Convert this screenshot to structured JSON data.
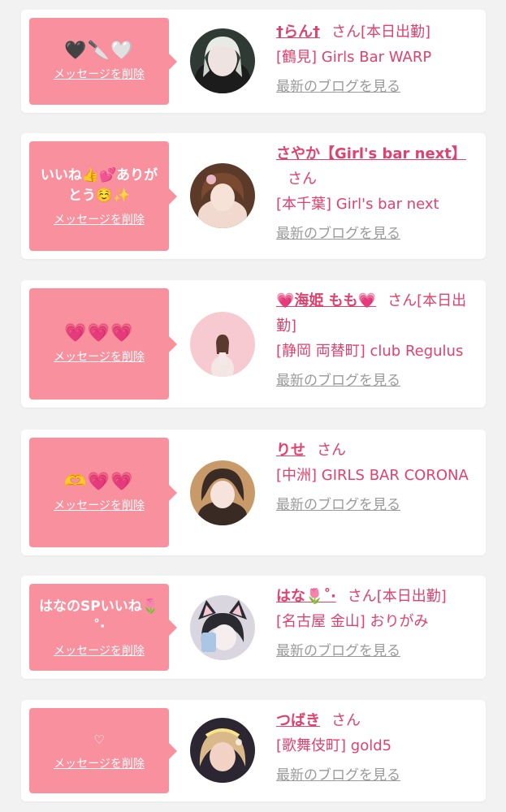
{
  "cards": [
    {
      "message": "🖤🔪🤍",
      "delete_label": "メッセージを削除",
      "name": "†らん†",
      "honorific": "さん",
      "status": "[本日出勤]",
      "shop": "[鶴見] Girls Bar WARP",
      "blog_link": "最新のブログを見る"
    },
    {
      "message": "いいね👍💕ありがとう☺️✨",
      "delete_label": "メッセージを削除",
      "name": "さやか【Girl's bar next】",
      "honorific": "さん",
      "status": "",
      "shop": "[本千葉] Girl's bar next",
      "blog_link": "最新のブログを見る"
    },
    {
      "message": "💗💗💗",
      "delete_label": "メッセージを削除",
      "name": "💗海姫 もも💗",
      "honorific": "さん",
      "status": "[本日出勤]",
      "shop": "[静岡 両替町] club Regulus",
      "blog_link": "最新のブログを見る"
    },
    {
      "message": "🫶💗💗",
      "delete_label": "メッセージを削除",
      "name": "りせ",
      "honorific": "さん",
      "status": "",
      "shop": "[中洲] GIRLS BAR CORONA",
      "blog_link": "最新のブログを見る"
    },
    {
      "message": "はなのSPいいね🌷˚‧",
      "delete_label": "メッセージを削除",
      "name": "はな🌷˚‧",
      "honorific": "さん",
      "status": "[本日出勤]",
      "shop": "[名古屋 金山] おりがみ",
      "blog_link": "最新のブログを見る"
    },
    {
      "message": "♡",
      "delete_label": "メッセージを削除",
      "name": "つばき",
      "honorific": "さん",
      "status": "",
      "shop": "[歌舞伎町] gold5",
      "blog_link": "最新のブログを見る"
    }
  ],
  "colors": {
    "accent": "#e0416d",
    "bubble": "#f9909e",
    "muted_link": "#9a9a9a",
    "background": "#f2f2f2"
  }
}
